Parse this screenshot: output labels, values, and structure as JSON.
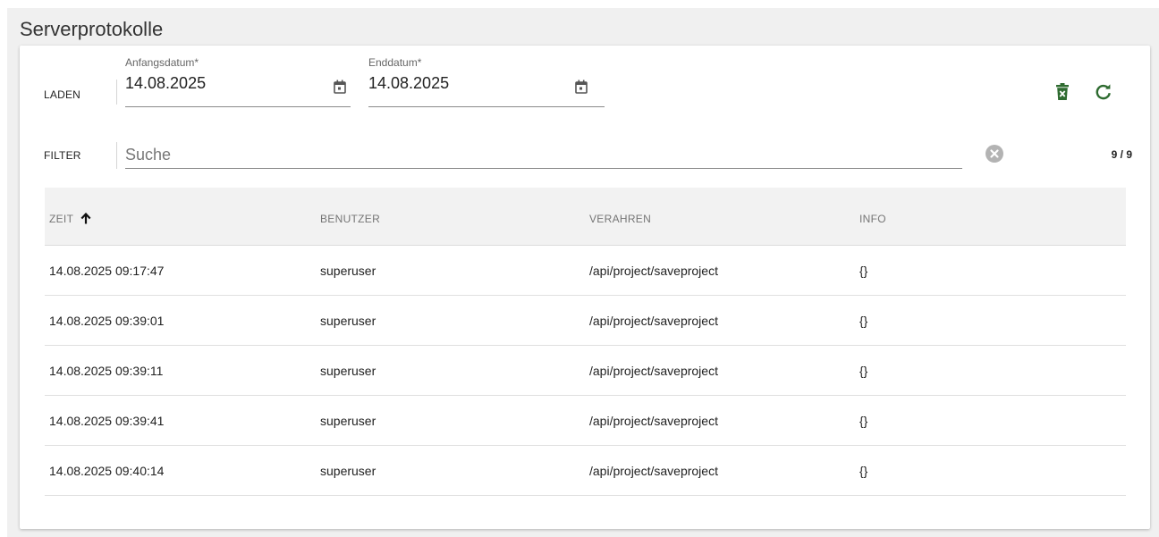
{
  "page": {
    "title": "Serverprotokolle"
  },
  "load": {
    "label": "LADEN",
    "start": {
      "label": "Anfangsdatum*",
      "value": "14.08.2025",
      "icon": "calendar-icon"
    },
    "end": {
      "label": "Enddatum*",
      "value": "14.08.2025",
      "icon": "calendar-icon"
    },
    "actions": {
      "delete_icon": "trash-x-icon",
      "refresh_icon": "refresh-icon",
      "accent_color": "#2e6b30"
    }
  },
  "filter": {
    "label": "FILTER",
    "placeholder": "Suche",
    "value": "",
    "clear_icon": "close-circle-icon",
    "count": "9 / 9"
  },
  "table": {
    "columns": [
      "ZEIT",
      "BENUTZER",
      "VERAHREN",
      "INFO"
    ],
    "sort": {
      "column": "ZEIT",
      "direction": "ascending",
      "icon": "arrow-up-icon"
    },
    "rows": [
      [
        "14.08.2025 09:17:47",
        "superuser",
        "/api/project/saveproject",
        "{}"
      ],
      [
        "14.08.2025 09:39:01",
        "superuser",
        "/api/project/saveproject",
        "{}"
      ],
      [
        "14.08.2025 09:39:11",
        "superuser",
        "/api/project/saveproject",
        "{}"
      ],
      [
        "14.08.2025 09:39:41",
        "superuser",
        "/api/project/saveproject",
        "{}"
      ],
      [
        "14.08.2025 09:40:14",
        "superuser",
        "/api/project/saveproject",
        "{}"
      ]
    ]
  }
}
